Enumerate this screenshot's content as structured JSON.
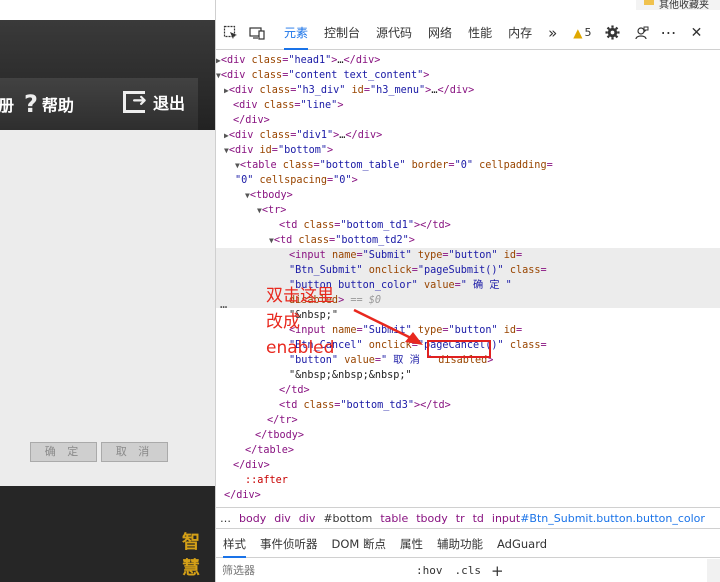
{
  "webpage": {
    "nav": {
      "left_partial": "册",
      "help": "帮助",
      "exit": "退出"
    },
    "buttons": {
      "confirm": "确 定",
      "cancel": "取 消"
    },
    "logo_partial": "智慧"
  },
  "browser_strip": {
    "folder_label": "其他收藏夹"
  },
  "devtools": {
    "tabs": [
      "元素",
      "控制台",
      "源代码",
      "网络",
      "性能",
      "内存"
    ],
    "more": "»",
    "warnings_count": "5",
    "menu_dots": "⋯",
    "close": "✕",
    "annotation": [
      "双击这里",
      "改成",
      "enabled"
    ],
    "selected_row_marker": "…",
    "breadcrumbs": [
      "…",
      "body",
      "div",
      "div",
      "#bottom",
      "table",
      "tbody",
      "tr",
      "td"
    ],
    "breadcrumb_last": {
      "tag": "input",
      "rest": "#Btn_Submit.button.button_color"
    },
    "styles_tabs": [
      "样式",
      "事件侦听器",
      "DOM 断点",
      "属性",
      "辅助功能",
      "AdGuard"
    ],
    "filter_placeholder": "筛选器",
    "hov": ":hov",
    "cls": ".cls",
    "plus": "+"
  },
  "colors": {
    "accent": "#1a73e8",
    "annotation": "#e8281e",
    "tag": "#881280"
  }
}
